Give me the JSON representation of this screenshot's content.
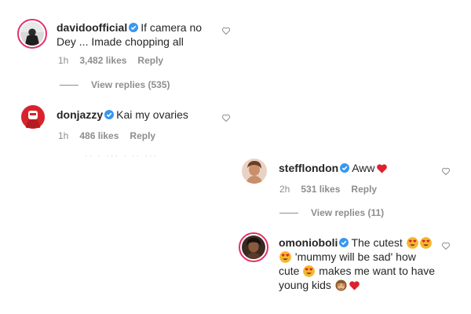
{
  "comments": [
    {
      "username": "davidoofficial",
      "text": "If camera no Dey ... Imade chopping all",
      "time": "1h",
      "likes": "3,482 likes",
      "reply_label": "Reply",
      "view_replies": "View replies (535)"
    },
    {
      "username": "donjazzy",
      "text": "Kai my ovaries",
      "time": "1h",
      "likes": "486 likes",
      "reply_label": "Reply"
    },
    {
      "username": "stefflondon",
      "text": "Aww",
      "time": "2h",
      "likes": "531 likes",
      "reply_label": "Reply",
      "view_replies": "View replies (11)"
    },
    {
      "username": "omonioboli",
      "text_part1": "The cutest",
      "text_part2": "'mummy will be sad' how cute",
      "text_part3": "makes me want to have young kids"
    }
  ],
  "colors": {
    "verified": "#3897f0",
    "muted": "#8e8e8e",
    "heart_red": "#ed4956",
    "story_ring": "#e1306c"
  },
  "icons": [
    "heart-outline-icon",
    "verified-badge-icon",
    "heart-eyes-emoji",
    "see-no-evil-monkey-emoji",
    "red-heart-emoji"
  ]
}
